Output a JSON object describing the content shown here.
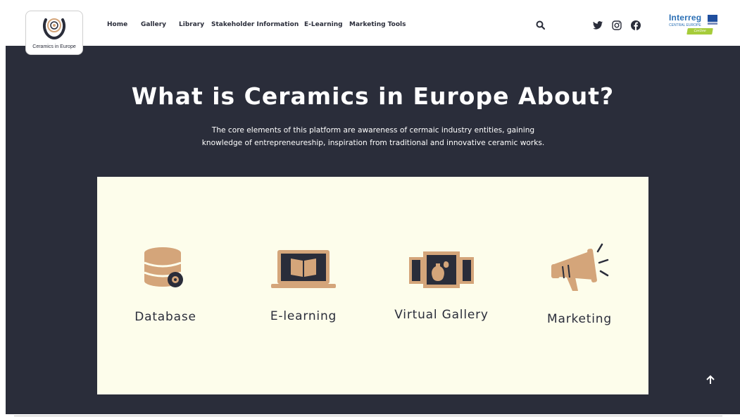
{
  "brand": {
    "logo_text": "Ceramics in Europe",
    "colors": {
      "dark": "#2a2d3a",
      "accent": "#d4a57a",
      "panel": "#fdfdeb",
      "white": "#ffffff"
    }
  },
  "nav": {
    "items": [
      {
        "label": "Home"
      },
      {
        "label": "Gallery"
      },
      {
        "label": "Library"
      },
      {
        "label": "Stakeholder Information"
      },
      {
        "label": "E-Learning"
      },
      {
        "label": "Marketing Tools"
      }
    ],
    "icons": [
      "search-icon",
      "twitter-icon",
      "instagram-icon",
      "facebook-icon"
    ]
  },
  "partner": {
    "name": "Interreg",
    "region": "CENTRAL EUROPE",
    "project": "CerDee"
  },
  "hero": {
    "title": "What is Ceramics in Europe About?",
    "description": "The core elements of this platform are awareness of cermaic industry entities, gaining knowledge of entrepreneureship, inspiration from traditional and innovative ceramic works."
  },
  "features": [
    {
      "label": "Database",
      "icon": "database-icon"
    },
    {
      "label": "E-learning",
      "icon": "laptop-book-icon"
    },
    {
      "label": "Virtual Gallery",
      "icon": "gallery-frames-icon"
    },
    {
      "label": "Marketing",
      "icon": "megaphone-icon"
    }
  ],
  "scroll_top_icon": "arrow-up-icon"
}
